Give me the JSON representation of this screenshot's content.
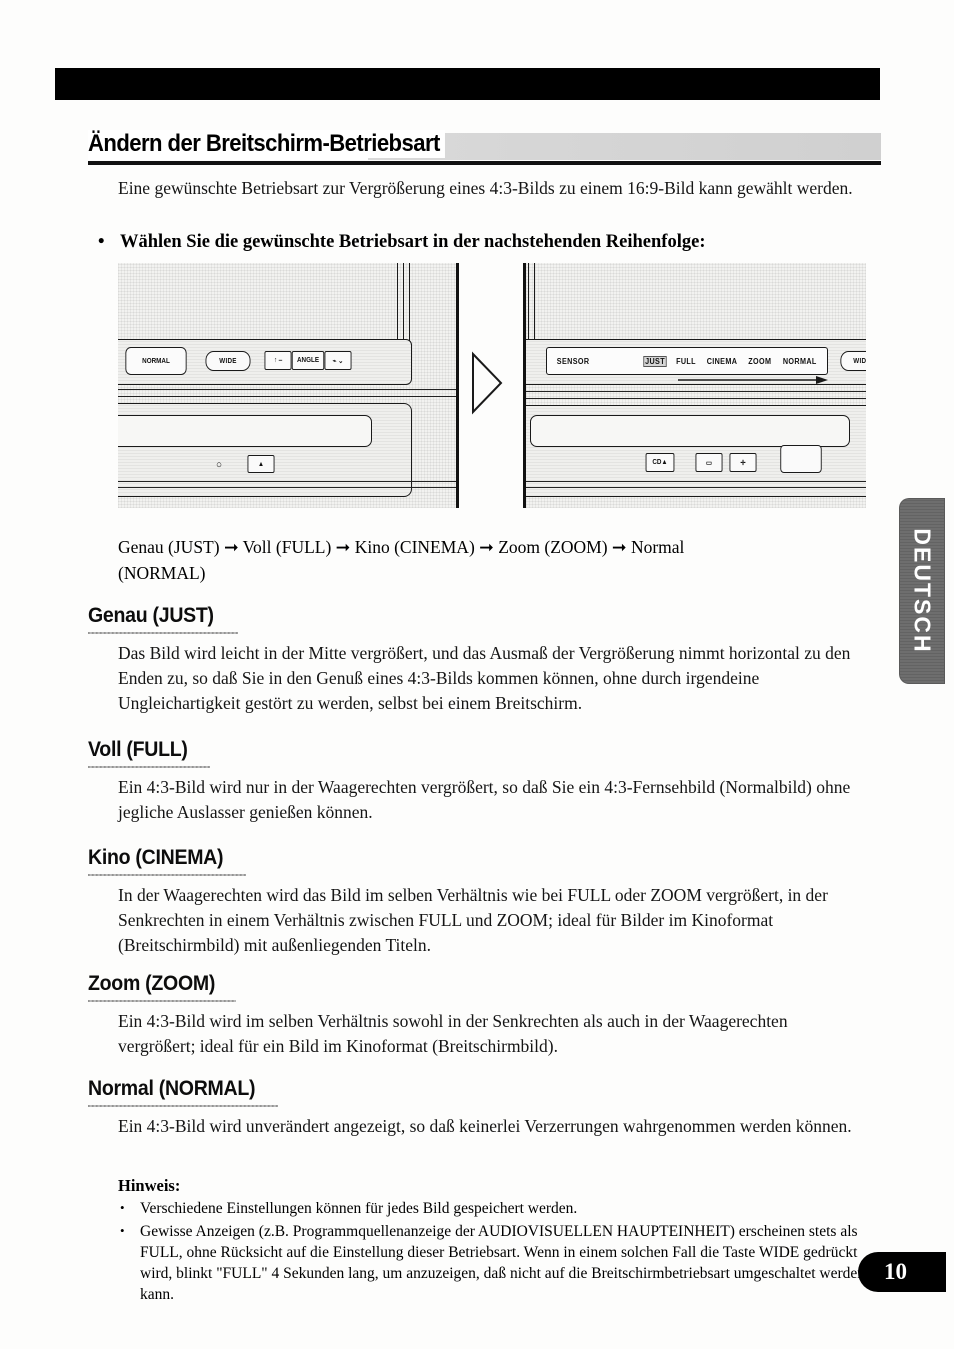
{
  "page": {
    "number": "10",
    "language_tab": "DEUTSCH"
  },
  "section": {
    "title": "Ändern der Breitschirm-Betriebsart",
    "intro": "Eine gewünschte Betriebsart zur Vergrößerung eines 4:3-Bilds zu einem 16:9-Bild kann gewählt werden.",
    "bullet_lead": "Wählen Sie die gewünschte Betriebsart in der nachstehenden Reihenfolge:",
    "bullet_marker": "•"
  },
  "illustration": {
    "left_device": {
      "labels": {
        "normal": "NORMAL",
        "wide": "WIDE",
        "angle": "ANGLE",
        "angle_left": "↑ ⎯",
        "angle_right": "⌁ ⌄",
        "eject": "▲",
        "knob": "○"
      }
    },
    "transition_icon": "triangle-right-icon",
    "right_device": {
      "labels": {
        "sensor": "SENSOR",
        "wide": "WIDE",
        "cd_eject": "CD▲",
        "minus": "▭",
        "plus": "✛"
      },
      "osd_modes": [
        "JUST",
        "FULL",
        "CINEMA",
        "ZOOM",
        "NORMAL"
      ],
      "osd_highlighted": "JUST"
    }
  },
  "sequence": {
    "arrow": "➞",
    "steps": [
      "Genau (JUST)",
      "Voll (FULL)",
      "Kino (CINEMA)",
      "Zoom (ZOOM)",
      "Normal (NORMAL)"
    ],
    "line1": "Genau (JUST) ➞ Voll (FULL) ➞ Kino (CINEMA) ➞ Zoom (ZOOM) ➞ Normal",
    "line2": "(NORMAL)"
  },
  "modes": [
    {
      "heading": "Genau (JUST)",
      "body": "Das Bild wird leicht in der Mitte vergrößert, und das Ausmaß der Vergrößerung nimmt horizontal zu den Enden zu, so daß Sie in den Genuß eines 4:3-Bilds kommen können, ohne durch irgendeine Ungleichartigkeit gestört zu werden, selbst bei einem Breitschirm."
    },
    {
      "heading": "Voll (FULL)",
      "body": "Ein 4:3-Bild wird nur in der Waagerechten vergrößert, so daß Sie ein 4:3-Fernsehbild (Normalbild) ohne jegliche Auslasser genießen können."
    },
    {
      "heading": "Kino (CINEMA)",
      "body": "In der Waagerechten wird das Bild im selben Verhältnis wie bei FULL oder ZOOM vergrößert, in der Senkrechten in einem Verhältnis zwischen FULL und ZOOM; ideal für Bilder im Kinoformat (Breitschirmbild) mit außenliegenden Titeln."
    },
    {
      "heading": "Zoom (ZOOM)",
      "body": "Ein 4:3-Bild wird im selben Verhältnis sowohl in der Senkrechten als auch in der Waagerechten vergrößert; ideal für ein Bild im Kinoformat (Breitschirmbild)."
    },
    {
      "heading": "Normal (NORMAL)",
      "body": "Ein 4:3-Bild wird unverändert angezeigt, so daß keinerlei Verzerrungen wahrgenommen werden können."
    }
  ],
  "note": {
    "title": "Hinweis:",
    "marker": "•",
    "items": [
      "Verschiedene Einstellungen können für jedes Bild gespeichert werden.",
      "Gewisse Anzeigen (z.B. Programmquellenanzeige der AUDIOVISUELLEN HAUPTEINHEIT) erscheinen stets als FULL, ohne Rücksicht auf die Einstellung dieser Betriebsart. Wenn in einem solchen Fall die Taste WIDE gedrückt wird, blinkt \"FULL\" 4 Sekunden lang, um anzuzeigen, daß nicht auf die Breitschirmbetriebsart umgeschaltet werden kann."
    ]
  }
}
